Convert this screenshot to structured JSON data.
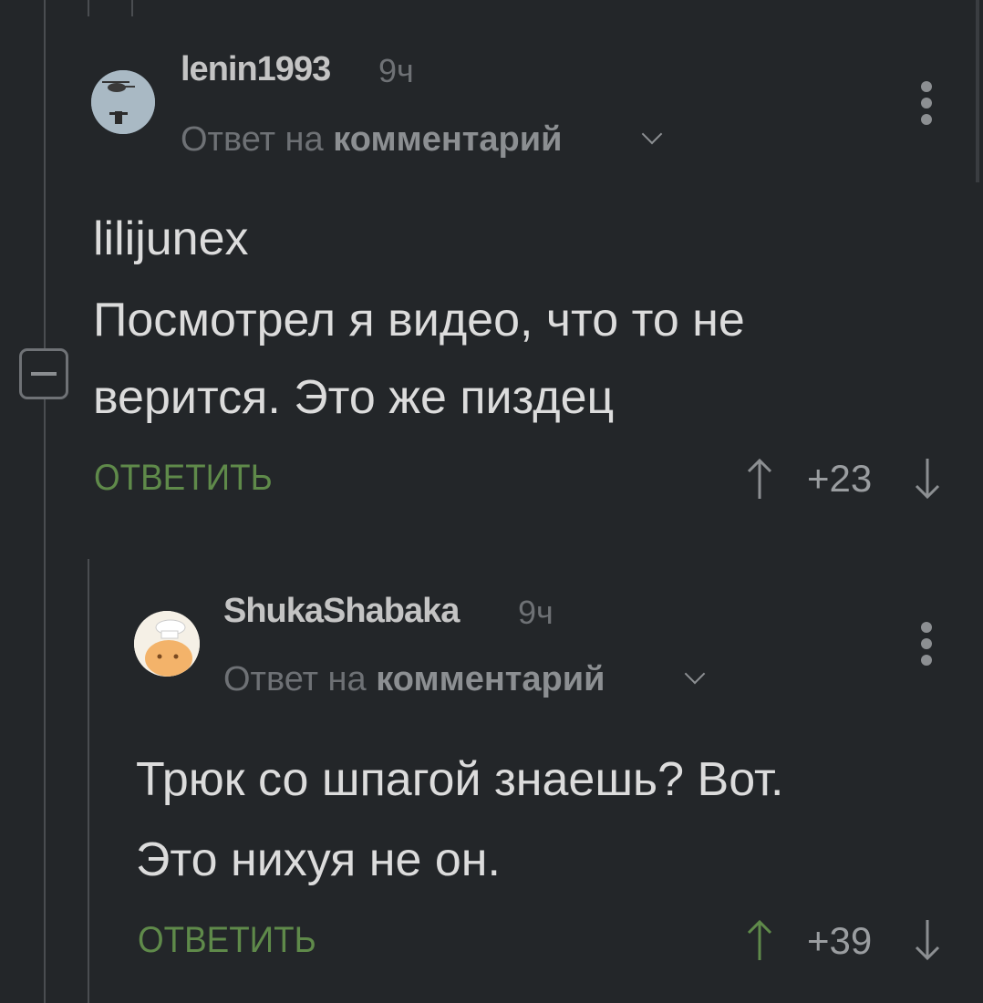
{
  "comments": [
    {
      "author": "lenin1993",
      "time": "9ч",
      "reply_prefix": "Ответ на",
      "reply_link": "комментарий",
      "lines": [
        "lilijunex",
        "Посмотрел я видео, что то не",
        "верится. Это же пиздец"
      ],
      "reply_label": "ОТВЕТИТЬ",
      "score": "+23",
      "upvoted": false
    },
    {
      "author": "ShukaShabaka",
      "time": "9ч",
      "reply_prefix": "Ответ на",
      "reply_link": "комментарий",
      "lines": [
        "Трюк со шпагой знаешь? Вот.",
        "Это нихуя не он."
      ],
      "reply_label": "ОТВЕТИТЬ",
      "score": "+39",
      "upvoted": true
    }
  ],
  "colors": {
    "background": "#232629",
    "reply_green": "#5f8a4a",
    "upvote_active": "#5f8a4a",
    "vote_inactive": "#8c8f92"
  }
}
